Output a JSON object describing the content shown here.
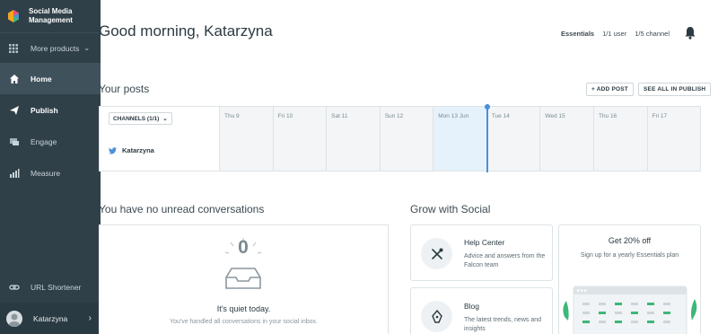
{
  "brand": {
    "name_line1": "Social Media",
    "name_line2": "Management"
  },
  "sidebar": {
    "more": "More products",
    "items": [
      {
        "label": "Home",
        "icon": "home-icon"
      },
      {
        "label": "Publish",
        "icon": "paper-plane-icon"
      },
      {
        "label": "Engage",
        "icon": "chat-icon"
      },
      {
        "label": "Measure",
        "icon": "bar-chart-icon"
      }
    ],
    "url_shortener": "URL Shortener",
    "user": "Katarzyna"
  },
  "header": {
    "greeting": "Good morning, Katarzyna",
    "plan": "Essentials",
    "users": "1/1 user",
    "channels": "1/5 channel"
  },
  "posts": {
    "title": "Your posts",
    "add_post": "+ ADD POST",
    "see_all": "SEE ALL IN PUBLISH",
    "channels_filter": "CHANNELS (1/1)",
    "account": "Katarzyna",
    "days": [
      "Thu 9",
      "Fri 10",
      "Sat 11",
      "Sun 12",
      "Mon 13 Jun",
      "Tue 14",
      "Wed 15",
      "Thu 16",
      "Fri 17"
    ]
  },
  "conversations": {
    "title": "You have no unread conversations",
    "count": "0",
    "quiet": "It's quiet today.",
    "sub": "You've handled all conversations in your social inbox."
  },
  "grow": {
    "title": "Grow with Social",
    "help_title": "Help Center",
    "help_desc": "Advice and answers from the Falcon team",
    "blog_title": "Blog",
    "blog_desc": "The latest trends, news and insights",
    "offer_title": "Get 20% off",
    "offer_desc": "Sign up for a yearly Essentials plan"
  },
  "colors": {
    "sidebar": "#2f4049",
    "accent": "#4a90d9",
    "green": "#3cb878"
  }
}
